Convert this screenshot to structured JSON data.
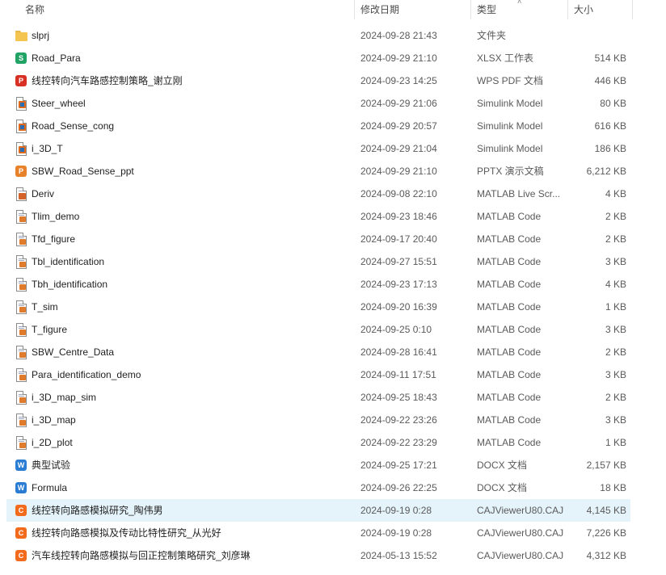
{
  "columns": {
    "name": "名称",
    "date": "修改日期",
    "type": "类型",
    "size": "大小"
  },
  "colors": {
    "selected_row": "#e5f3fb",
    "xlsx": "#21a366",
    "pdf": "#d93025",
    "ppt": "#e8822a",
    "word": "#2b7cd3",
    "caj": "#f26b1d"
  },
  "files": [
    {
      "icon": "folder-icon",
      "name": "slprj",
      "date": "2024-09-28 21:43",
      "type": "文件夹",
      "size": ""
    },
    {
      "icon": "xlsx-icon",
      "name": "Road_Para",
      "date": "2024-09-29 21:10",
      "type": "XLSX 工作表",
      "size": "514 KB"
    },
    {
      "icon": "pdf-icon",
      "name": "线控转向汽车路感控制策略_谢立刚",
      "date": "2024-09-23 14:25",
      "type": "WPS PDF 文档",
      "size": "446 KB"
    },
    {
      "icon": "simulink-icon",
      "name": "Steer_wheel",
      "date": "2024-09-29 21:06",
      "type": "Simulink Model",
      "size": "80 KB"
    },
    {
      "icon": "simulink-icon",
      "name": "Road_Sense_cong",
      "date": "2024-09-29 20:57",
      "type": "Simulink Model",
      "size": "616 KB"
    },
    {
      "icon": "simulink-icon",
      "name": "i_3D_T",
      "date": "2024-09-29 21:04",
      "type": "Simulink Model",
      "size": "186 KB"
    },
    {
      "icon": "pptx-icon",
      "name": "SBW_Road_Sense_ppt",
      "date": "2024-09-29 21:10",
      "type": "PPTX 演示文稿",
      "size": "6,212 KB"
    },
    {
      "icon": "matlab-live-script-icon",
      "name": "Deriv",
      "date": "2024-09-08 22:10",
      "type": "MATLAB Live Scr...",
      "size": "4 KB"
    },
    {
      "icon": "matlab-code-icon",
      "name": "Tlim_demo",
      "date": "2024-09-23 18:46",
      "type": "MATLAB Code",
      "size": "2 KB"
    },
    {
      "icon": "matlab-code-icon",
      "name": "Tfd_figure",
      "date": "2024-09-17 20:40",
      "type": "MATLAB Code",
      "size": "2 KB"
    },
    {
      "icon": "matlab-code-icon",
      "name": "Tbl_identification",
      "date": "2024-09-27 15:51",
      "type": "MATLAB Code",
      "size": "3 KB"
    },
    {
      "icon": "matlab-code-icon",
      "name": "Tbh_identification",
      "date": "2024-09-23 17:13",
      "type": "MATLAB Code",
      "size": "4 KB"
    },
    {
      "icon": "matlab-code-icon",
      "name": "T_sim",
      "date": "2024-09-20 16:39",
      "type": "MATLAB Code",
      "size": "1 KB"
    },
    {
      "icon": "matlab-code-icon",
      "name": "T_figure",
      "date": "2024-09-25 0:10",
      "type": "MATLAB Code",
      "size": "3 KB"
    },
    {
      "icon": "matlab-code-icon",
      "name": "SBW_Centre_Data",
      "date": "2024-09-28 16:41",
      "type": "MATLAB Code",
      "size": "2 KB"
    },
    {
      "icon": "matlab-code-icon",
      "name": "Para_identification_demo",
      "date": "2024-09-11 17:51",
      "type": "MATLAB Code",
      "size": "3 KB"
    },
    {
      "icon": "matlab-code-icon",
      "name": "i_3D_map_sim",
      "date": "2024-09-25 18:43",
      "type": "MATLAB Code",
      "size": "2 KB"
    },
    {
      "icon": "matlab-code-icon",
      "name": "i_3D_map",
      "date": "2024-09-22 23:26",
      "type": "MATLAB Code",
      "size": "3 KB"
    },
    {
      "icon": "matlab-code-icon",
      "name": "i_2D_plot",
      "date": "2024-09-22 23:29",
      "type": "MATLAB Code",
      "size": "1 KB"
    },
    {
      "icon": "docx-icon",
      "name": "典型试验",
      "date": "2024-09-25 17:21",
      "type": "DOCX 文档",
      "size": "2,157 KB"
    },
    {
      "icon": "docx-icon",
      "name": "Formula",
      "date": "2024-09-26 22:25",
      "type": "DOCX 文档",
      "size": "18 KB"
    },
    {
      "icon": "caj-icon",
      "name": "线控转向路感模拟研究_陶伟男",
      "date": "2024-09-19 0:28",
      "type": "CAJViewerU80.CAJ",
      "size": "4,145 KB",
      "selected": true
    },
    {
      "icon": "caj-icon",
      "name": "线控转向路感模拟及传动比特性研究_从光好",
      "date": "2024-09-19 0:28",
      "type": "CAJViewerU80.CAJ",
      "size": "7,226 KB"
    },
    {
      "icon": "caj-icon",
      "name": "汽车线控转向路感模拟与回正控制策略研究_刘彦琳",
      "date": "2024-05-13 15:52",
      "type": "CAJViewerU80.CAJ",
      "size": "4,312 KB"
    }
  ]
}
